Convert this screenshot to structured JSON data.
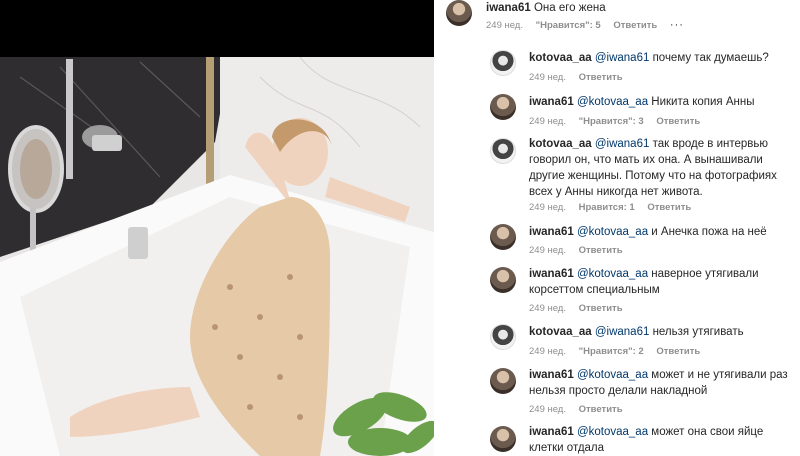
{
  "post": {
    "author": "iwana61",
    "caption": "Она его жена",
    "age": "249 нед.",
    "likes": "\"Нравится\": 5",
    "reply": "Ответить",
    "more": "···"
  },
  "comments": [
    {
      "user": "kotovaa_aa",
      "mention": "@iwana61",
      "text": " почему так думаешь?",
      "age": "249 нед.",
      "likes": "",
      "reply": "Ответить"
    },
    {
      "user": "iwana61",
      "mention": "@kotovaa_aa",
      "text": " Никита копия Анны",
      "age": "249 нед.",
      "likes": "\"Нравится\": 3",
      "reply": "Ответить"
    },
    {
      "user": "kotovaa_aa",
      "mention": "@iwana61",
      "text": " так вроде в интервью говорил он, что мать их она. А вынашивали другие женщины. Потому что на фотографиях всех у Анны никогда нет живота.",
      "age": "249 нед.",
      "likes": "Нравится: 1",
      "reply": "Ответить"
    },
    {
      "user": "iwana61",
      "mention": "@kotovaa_aa",
      "text": " и Анечка пожа на неё",
      "age": "249 нед.",
      "likes": "",
      "reply": "Ответить"
    },
    {
      "user": "iwana61",
      "mention": "@kotovaa_aa",
      "text": " наверное утягивали корсеттом специальным",
      "age": "249 нед.",
      "likes": "",
      "reply": "Ответить"
    },
    {
      "user": "kotovaa_aa",
      "mention": "@iwana61",
      "text": " нельзя утягивать",
      "age": "249 нед.",
      "likes": "\"Нравится\": 2",
      "reply": "Ответить"
    },
    {
      "user": "iwana61",
      "mention": "@kotovaa_aa",
      "text": " может и не утягивали раз нельзя просто делали накладной",
      "age": "249 нед.",
      "likes": "",
      "reply": "Ответить"
    },
    {
      "user": "iwana61",
      "mention": "@kotovaa_aa",
      "text": " может она свои яйце клетки отдала",
      "age": "",
      "likes": "",
      "reply": ""
    }
  ]
}
